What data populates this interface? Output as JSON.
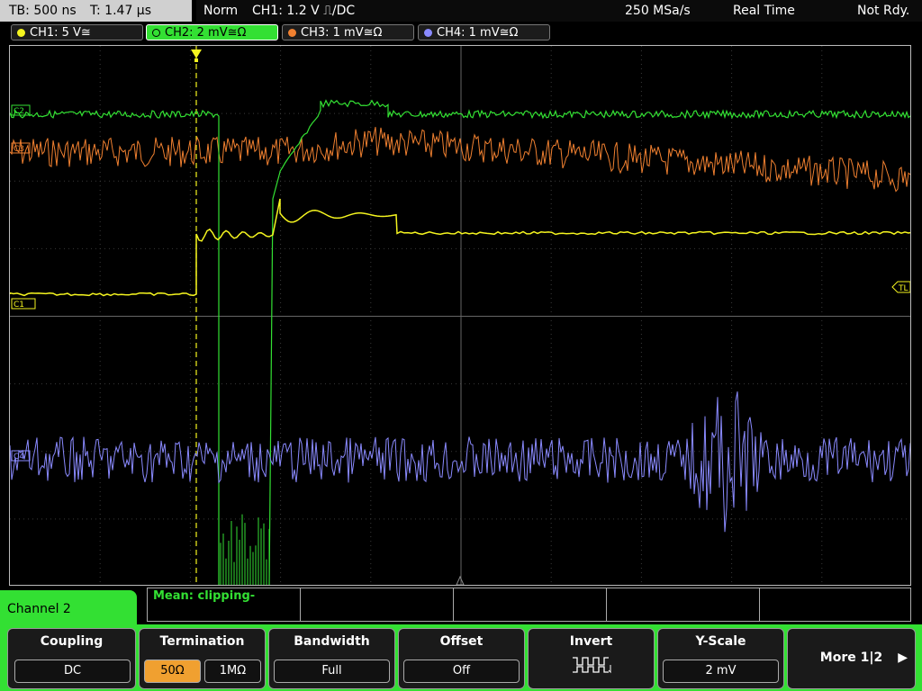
{
  "status_bar": {
    "timebase": "TB: 500 ns",
    "trigger_time": "T: 1.47 µs",
    "trigger_mode": "Norm",
    "trigger_setting": "CH1: 1.2 V ⎍/DC",
    "sample_rate": "250 MSa/s",
    "acquisition_mode": "Real Time",
    "ready_state": "Not Rdy."
  },
  "channels": [
    {
      "label": "CH1: 5 V≅",
      "color": "#f5f51f",
      "active": false
    },
    {
      "label": "CH2: 2 mV≅Ω",
      "color": "#33e033",
      "active": true
    },
    {
      "label": "CH3: 1 mV≅Ω",
      "color": "#f08030",
      "active": false
    },
    {
      "label": "CH4: 1 mV≅Ω",
      "color": "#8a8aff",
      "active": false
    }
  ],
  "markers": {
    "c2": "C2",
    "c3": "C3",
    "c1": "C1",
    "c4": "C4",
    "trigger_level": "TL"
  },
  "measurement": {
    "text": "Mean: clipping-"
  },
  "softkeys": {
    "menu_title": "Channel 2",
    "coupling": {
      "title": "Coupling",
      "value": "DC"
    },
    "termination": {
      "title": "Termination",
      "option_1": "50Ω",
      "option_2": "1MΩ",
      "selected": "50Ω"
    },
    "bandwidth": {
      "title": "Bandwidth",
      "value": "Full"
    },
    "offset": {
      "title": "Offset",
      "value": "Off"
    },
    "invert": {
      "title": "Invert",
      "icon": "invert-waveform-icon"
    },
    "yscale": {
      "title": "Y-Scale",
      "value": "2 mV"
    },
    "more": {
      "label": "More 1|2",
      "icon": "play-arrow-icon"
    }
  }
}
